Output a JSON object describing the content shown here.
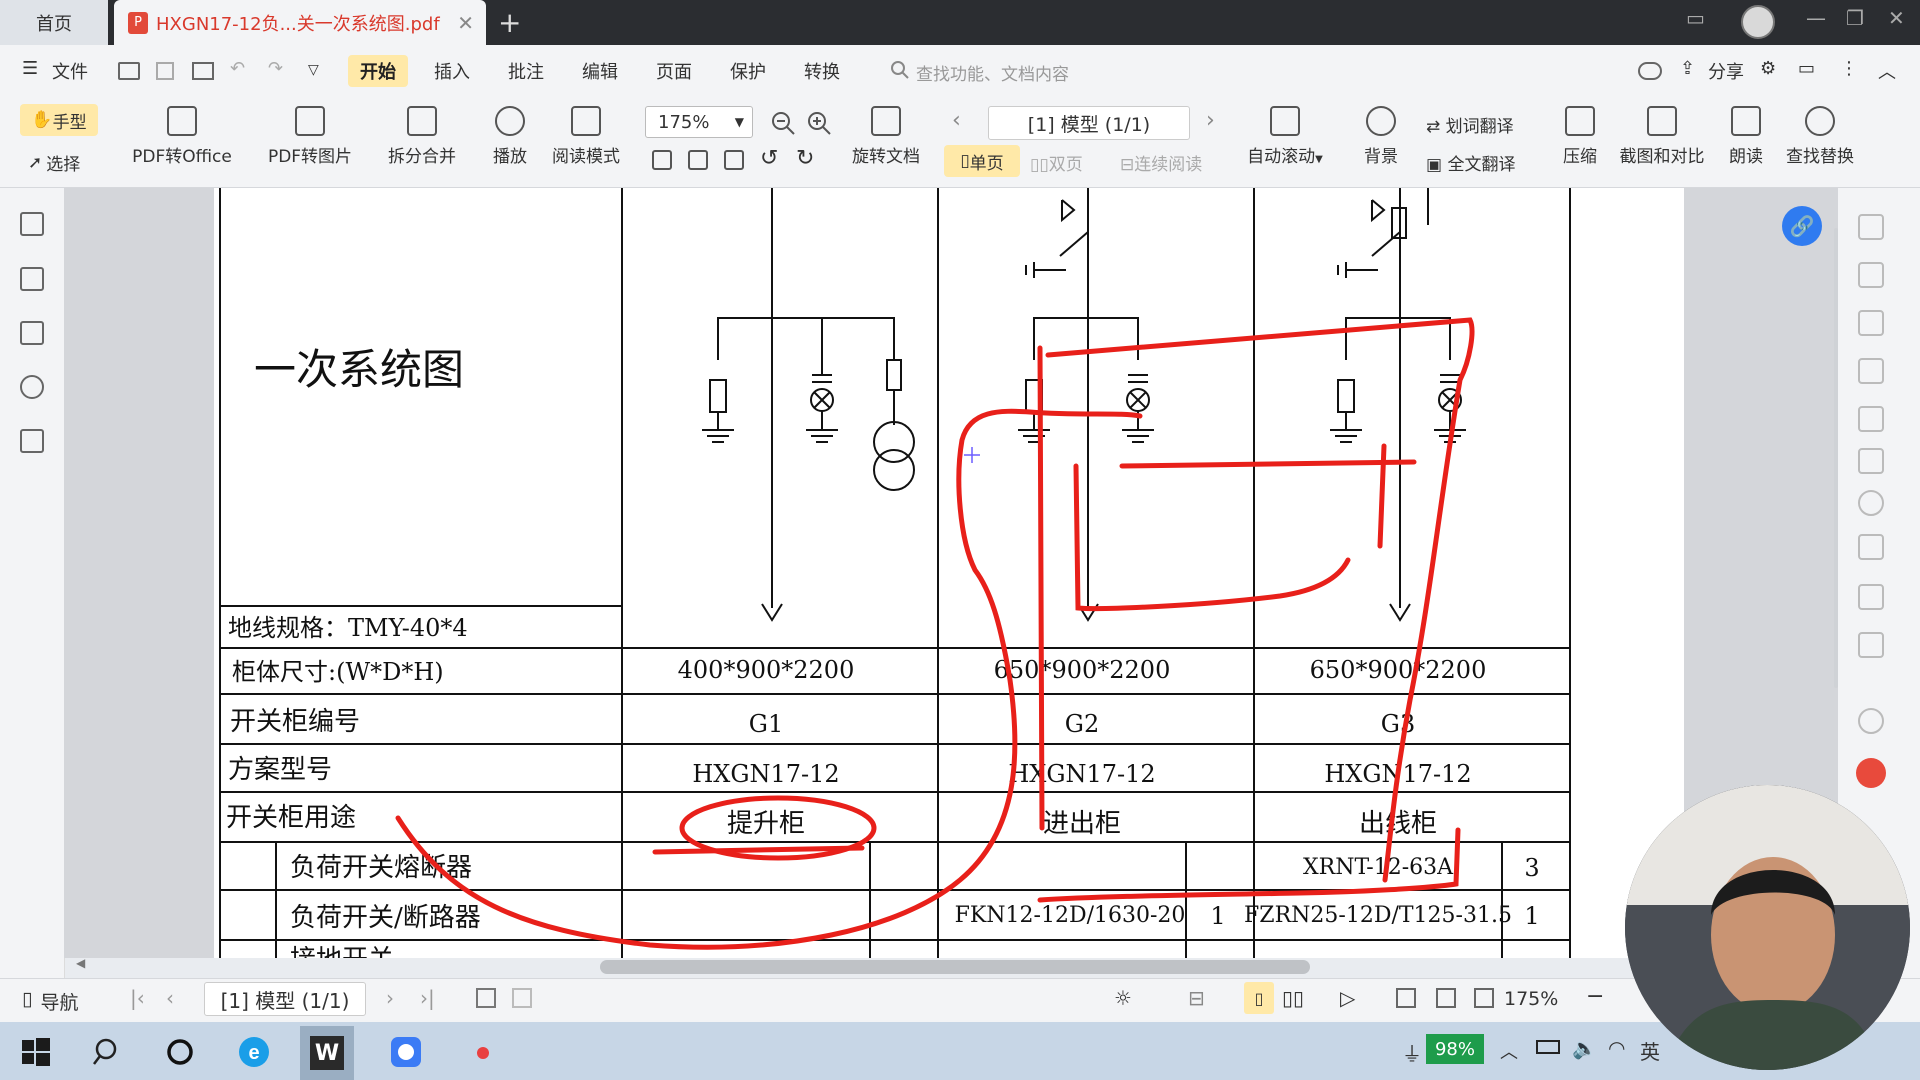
{
  "tabs": {
    "home": "首页",
    "document": "HXGN17-12负...关一次系统图.pdf"
  },
  "menu": {
    "file": "文件",
    "items": [
      "开始",
      "插入",
      "批注",
      "编辑",
      "页面",
      "保护",
      "转换"
    ],
    "search_placeholder": "查找功能、文档内容",
    "share": "分享"
  },
  "ribbon": {
    "hand": "手型",
    "select": "选择",
    "pdf_to_office": "PDF转Office",
    "pdf_to_image": "PDF转图片",
    "split_merge": "拆分合并",
    "play": "播放",
    "read_mode": "阅读模式",
    "zoom": "175%",
    "rotate_doc": "旋转文档",
    "page_indicator": "[1] 模型 (1/1)",
    "single_page": "单页",
    "double_page": "双页",
    "continuous": "连续阅读",
    "auto_scroll": "自动滚动",
    "background": "背景",
    "word_translate": "划词翻译",
    "full_translate": "全文翻译",
    "compress": "压缩",
    "screenshot_compare": "截图和对比",
    "read_aloud": "朗读",
    "find_replace": "查找替换"
  },
  "drawing": {
    "title": "一次系统图",
    "ground_spec": "地线规格：TMY-40*4",
    "rows": {
      "size_label": "柜体尺寸:(W*D*H)",
      "number_label": "开关柜编号",
      "scheme_label": "方案型号",
      "usage_label": "开关柜用途",
      "fuse_label": "负荷开关熔断器",
      "breaker_label": "负荷开关/断路器",
      "next_label": "接地开关"
    },
    "columns": [
      {
        "size": "400*900*2200",
        "number": "G1",
        "scheme": "HXGN17-12",
        "usage": "提升柜",
        "fuse": "",
        "fuse_qty": "",
        "breaker": "",
        "breaker_qty": ""
      },
      {
        "size": "650*900*2200",
        "number": "G2",
        "scheme": "HXGN17-12",
        "usage": "进出柜",
        "fuse": "",
        "fuse_qty": "",
        "breaker": "FKN12-12D/1630-20",
        "breaker_qty": "1"
      },
      {
        "size": "650*900*2200",
        "number": "G3",
        "scheme": "HXGN17-12",
        "usage": "出线柜",
        "fuse": "XRNT-12-63A",
        "fuse_qty": "3",
        "breaker": "FZRN25-12D/T125-31.5",
        "breaker_qty": "1"
      }
    ]
  },
  "status": {
    "nav": "导航",
    "page": "[1] 模型 (1/1)",
    "zoom": "175%"
  },
  "taskbar": {
    "battery": "98%",
    "ime": "英"
  }
}
